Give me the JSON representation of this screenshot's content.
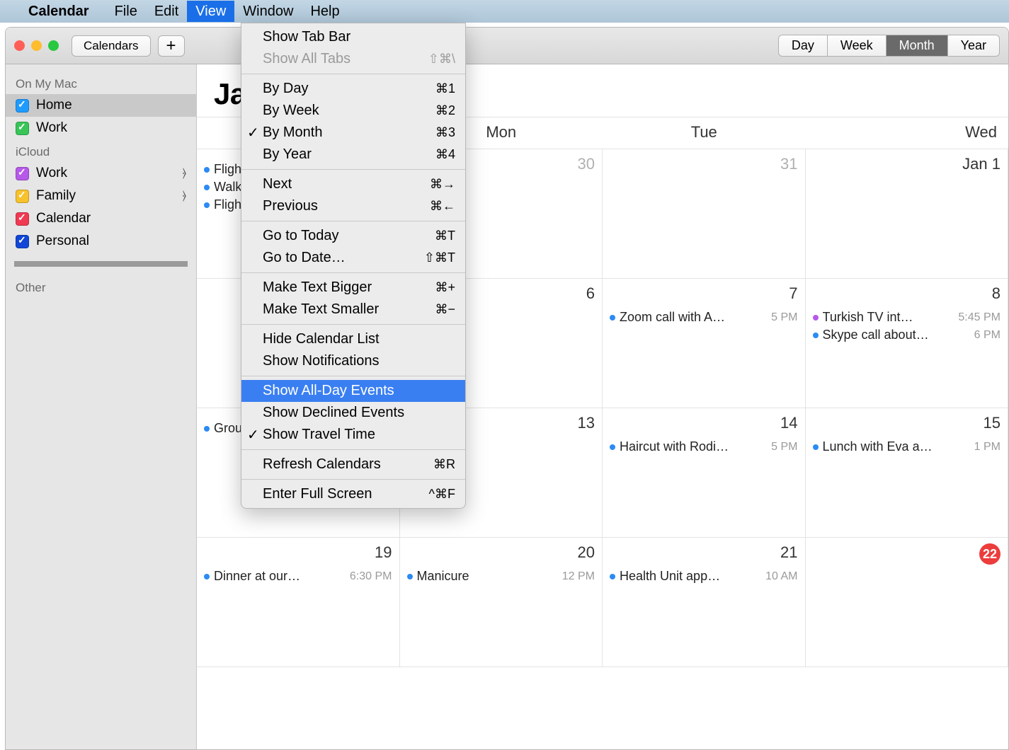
{
  "menubar": {
    "app": "Calendar",
    "items": [
      "File",
      "Edit",
      "View",
      "Window",
      "Help"
    ],
    "open_index": 2
  },
  "toolbar": {
    "calendars_btn": "Calendars",
    "add_btn": "+",
    "view_modes": [
      "Day",
      "Week",
      "Month",
      "Year"
    ],
    "active_mode": 2
  },
  "sidebar": {
    "sections": [
      {
        "heading": "On My Mac",
        "items": [
          {
            "label": "Home",
            "color": "#1f9bff",
            "selected": true,
            "shared": false
          },
          {
            "label": "Work",
            "color": "#39c558",
            "selected": false,
            "shared": false
          }
        ]
      },
      {
        "heading": "iCloud",
        "items": [
          {
            "label": "Work",
            "color": "#b659e8",
            "selected": false,
            "shared": true
          },
          {
            "label": "Family",
            "color": "#f8c22c",
            "selected": false,
            "shared": true
          },
          {
            "label": "Calendar",
            "color": "#ef3a52",
            "selected": false,
            "shared": false
          },
          {
            "label": "Personal",
            "color": "#1246d6",
            "selected": false,
            "shared": false
          }
        ]
      }
    ],
    "other_heading": "Other"
  },
  "title": "Ja",
  "weekdays": [
    "",
    "Mon",
    "Tue",
    "Wed"
  ],
  "dropdown": [
    {
      "type": "item",
      "label": "Show Tab Bar"
    },
    {
      "type": "item",
      "label": "Show All Tabs",
      "shortcut": "⇧⌘\\",
      "disabled": true
    },
    {
      "type": "sep"
    },
    {
      "type": "item",
      "label": "By Day",
      "shortcut": "⌘1"
    },
    {
      "type": "item",
      "label": "By Week",
      "shortcut": "⌘2"
    },
    {
      "type": "item",
      "label": "By Month",
      "shortcut": "⌘3",
      "checked": true
    },
    {
      "type": "item",
      "label": "By Year",
      "shortcut": "⌘4"
    },
    {
      "type": "sep"
    },
    {
      "type": "item",
      "label": "Next",
      "shortcut": "⌘→"
    },
    {
      "type": "item",
      "label": "Previous",
      "shortcut": "⌘←"
    },
    {
      "type": "sep"
    },
    {
      "type": "item",
      "label": "Go to Today",
      "shortcut": "⌘T"
    },
    {
      "type": "item",
      "label": "Go to Date…",
      "shortcut": "⇧⌘T"
    },
    {
      "type": "sep"
    },
    {
      "type": "item",
      "label": "Make Text Bigger",
      "shortcut": "⌘+"
    },
    {
      "type": "item",
      "label": "Make Text Smaller",
      "shortcut": "⌘−"
    },
    {
      "type": "sep"
    },
    {
      "type": "item",
      "label": "Hide Calendar List"
    },
    {
      "type": "item",
      "label": "Show Notifications"
    },
    {
      "type": "sep"
    },
    {
      "type": "item",
      "label": "Show All-Day Events",
      "highlight": true
    },
    {
      "type": "item",
      "label": "Show Declined Events"
    },
    {
      "type": "item",
      "label": "Show Travel Time",
      "checked": true
    },
    {
      "type": "sep"
    },
    {
      "type": "item",
      "label": "Refresh Calendars",
      "shortcut": "⌘R"
    },
    {
      "type": "sep"
    },
    {
      "type": "item",
      "label": "Enter Full Screen",
      "shortcut": "^⌘F"
    }
  ],
  "grid": [
    [
      {
        "date": "",
        "events": [
          {
            "text": "Flight",
            "color": "#2b8bf2"
          },
          {
            "text": "Walk",
            "color": "#2b8bf2"
          },
          {
            "text": "Flight",
            "color": "#2b8bf2"
          }
        ]
      },
      {
        "date": "30",
        "dim": true,
        "events": []
      },
      {
        "date": "31",
        "dim": true,
        "events": []
      },
      {
        "date": "Jan 1",
        "events": []
      }
    ],
    [
      {
        "date": "",
        "events": []
      },
      {
        "date": "6",
        "events": []
      },
      {
        "date": "7",
        "events": [
          {
            "text": "Zoom call with A…",
            "time": "5 PM",
            "color": "#2b8bf2"
          }
        ]
      },
      {
        "date": "8",
        "events": [
          {
            "text": "Turkish TV int…",
            "time": "5:45 PM",
            "color": "#b659e8"
          },
          {
            "text": "Skype call about…",
            "time": "6 PM",
            "color": "#2b8bf2"
          }
        ]
      }
    ],
    [
      {
        "date": "",
        "events": [
          {
            "text": "Group",
            "color": "#2b8bf2"
          }
        ]
      },
      {
        "date": "13",
        "events": []
      },
      {
        "date": "14",
        "events": [
          {
            "text": "Haircut with Rodi…",
            "time": "5 PM",
            "color": "#2b8bf2"
          }
        ]
      },
      {
        "date": "15",
        "events": [
          {
            "text": "Lunch with Eva a…",
            "time": "1 PM",
            "color": "#2b8bf2"
          }
        ]
      }
    ],
    [
      {
        "date": "19",
        "events": [
          {
            "text": "Dinner at our…",
            "time": "6:30 PM",
            "color": "#2b8bf2"
          }
        ]
      },
      {
        "date": "20",
        "events": [
          {
            "text": "Manicure",
            "time": "12 PM",
            "color": "#2b8bf2"
          }
        ]
      },
      {
        "date": "21",
        "events": [
          {
            "text": "Health Unit app…",
            "time": "10 AM",
            "color": "#2b8bf2"
          }
        ]
      },
      {
        "date": "22",
        "today": true,
        "events": []
      }
    ]
  ]
}
